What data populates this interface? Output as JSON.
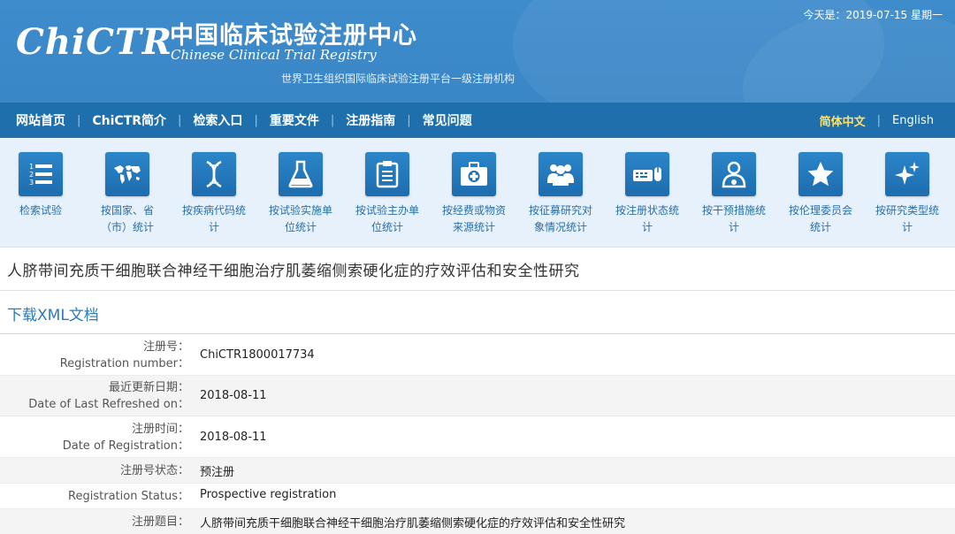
{
  "header": {
    "logo_text": "ChiCTR",
    "title_cn": "中国临床试验注册中心",
    "title_en": "Chinese Clinical Trial Registry",
    "subtitle": "世界卫生组织国际临床试验注册平台一级注册机构",
    "today": "今天是：2019-07-15 星期一"
  },
  "nav": {
    "items": [
      "网站首页",
      "ChiCTR简介",
      "检索入口",
      "重要文件",
      "注册指南",
      "常见问题"
    ],
    "separator": "|",
    "lang_cn": "简体中文",
    "lang_en": "English"
  },
  "icons": [
    {
      "icon": "list-numbered-icon",
      "line1": "检索试验",
      "line2": ""
    },
    {
      "icon": "world-map-icon",
      "line1": "按国家、省",
      "line2": "（市）统计"
    },
    {
      "icon": "dna-icon",
      "line1": "按疾病代码统",
      "line2": "计"
    },
    {
      "icon": "flask-icon",
      "line1": "按试验实施单",
      "line2": "位统计"
    },
    {
      "icon": "clipboard-icon",
      "line1": "按试验主办单",
      "line2": "位统计"
    },
    {
      "icon": "medical-kit-icon",
      "line1": "按经费或物资",
      "line2": "来源统计"
    },
    {
      "icon": "people-group-icon",
      "line1": "按征募研究对",
      "line2": "象情况统计"
    },
    {
      "icon": "keyboard-mouse-icon",
      "line1": "按注册状态统",
      "line2": "计"
    },
    {
      "icon": "doctor-icon",
      "line1": "按干预措施统",
      "line2": "计"
    },
    {
      "icon": "star-icon",
      "line1": "按伦理委员会",
      "line2": "统计"
    },
    {
      "icon": "sparkle-icon",
      "line1": "按研究类型统",
      "line2": "计"
    }
  ],
  "trial": {
    "title": "人脐带间充质干细胞联合神经干细胞治疗肌萎缩侧索硬化症的疗效评估和安全性研究",
    "xml_link": "下载XML文档"
  },
  "details": [
    {
      "label_cn": "注册号：",
      "label_en": "Registration number：",
      "value": "ChiCTR1800017734"
    },
    {
      "label_cn": "最近更新日期：",
      "label_en": "Date of Last Refreshed on：",
      "value": "2018-08-11"
    },
    {
      "label_cn": "注册时间：",
      "label_en": "Date of Registration：",
      "value": "2018-08-11"
    },
    {
      "label_cn": "注册号状态：",
      "label_en": "",
      "value": "预注册"
    },
    {
      "label_cn": "",
      "label_en": "Registration Status：",
      "value": "Prospective registration"
    },
    {
      "label_cn": "注册题目：",
      "label_en": "",
      "value": "人脐带间充质干细胞联合神经干细胞治疗肌萎缩侧索硬化症的疗效评估和安全性研究"
    }
  ]
}
